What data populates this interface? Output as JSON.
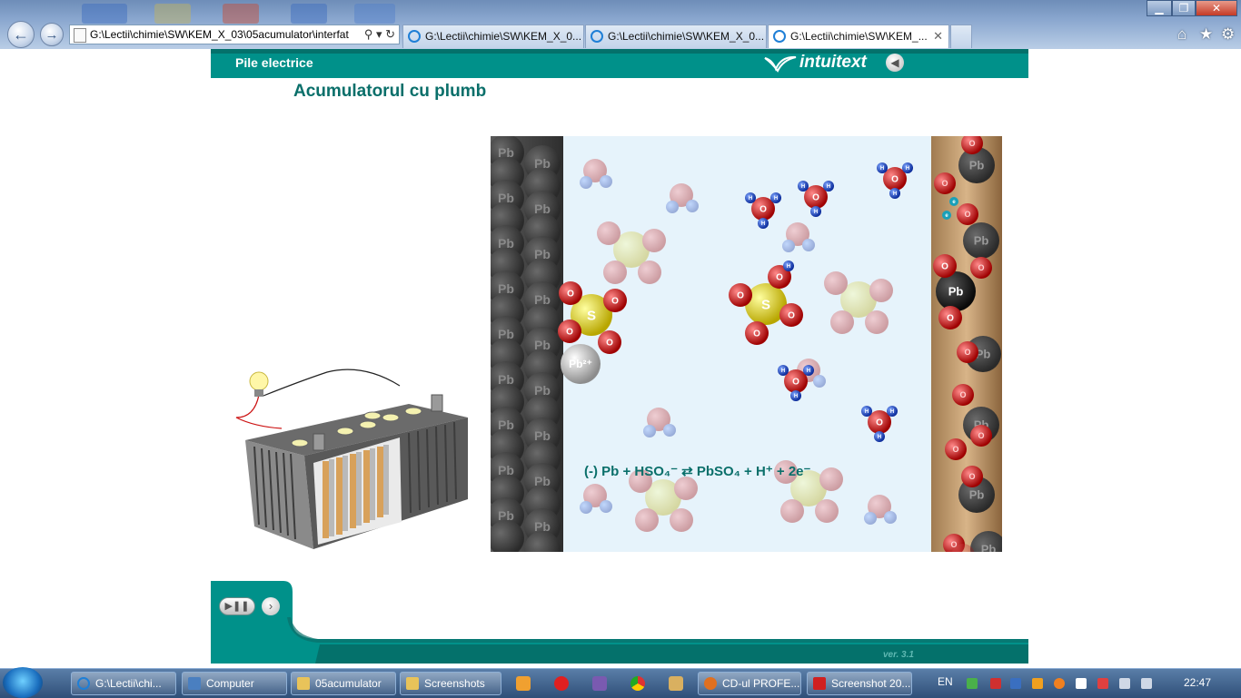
{
  "browser": {
    "address": "G:\\Lectii\\chimie\\SW\\KEM_X_03\\05acumulator\\interfat",
    "tabs": [
      {
        "label": "G:\\Lectii\\chimie\\SW\\KEM_X_0..."
      },
      {
        "label": "G:\\Lectii\\chimie\\SW\\KEM_X_0..."
      },
      {
        "label": "G:\\Lectii\\chimie\\SW\\KEM_..."
      }
    ],
    "tab_close": "✕",
    "search_refresh": "⚲ ▾ ↻"
  },
  "header": {
    "section": "Pile electrice",
    "brand": "intuitext",
    "title": "Acumulatorul cu plumb"
  },
  "simulation": {
    "electrode_label": "Pb",
    "equation": "(-) Pb + HSO₄⁻ ⇄ PbSO₄ + H⁺ + 2e⁻",
    "atoms": {
      "sulfur": "S",
      "oxygen": "O",
      "hydrogen": "H",
      "lead_ion": "Pb²⁺",
      "electron": "e"
    }
  },
  "footer": {
    "version": "ver. 3.1"
  },
  "taskbar": {
    "items": [
      {
        "label": "G:\\Lectii\\chi..."
      },
      {
        "label": "Computer"
      },
      {
        "label": "05acumulator"
      },
      {
        "label": "Screenshots"
      },
      {
        "label": "CD-ul PROFE..."
      },
      {
        "label": "Screenshot 20..."
      }
    ],
    "language": "EN",
    "clock": "22:47"
  },
  "colors": {
    "teal": "#00918a",
    "teal_dark": "#0a6f6a",
    "solution": "#e6f3fb"
  }
}
